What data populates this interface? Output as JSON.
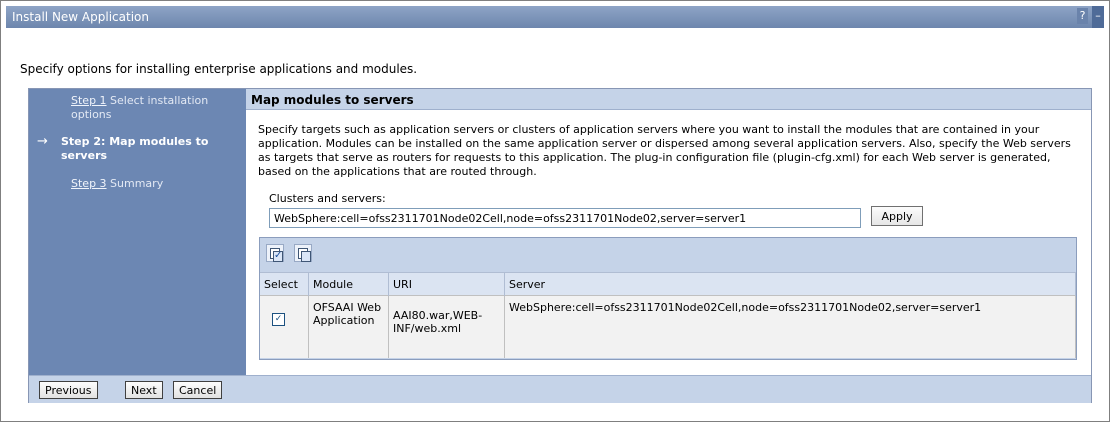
{
  "window": {
    "title": "Install New Application",
    "help": "?",
    "minimize": "–"
  },
  "intro": "Specify options for installing enterprise applications and modules.",
  "steps": [
    {
      "link": "Step 1",
      "label": "Select installation options"
    },
    {
      "arrow": "→",
      "label": "Step 2: Map modules to servers"
    },
    {
      "link": "Step 3",
      "label": "Summary"
    }
  ],
  "content": {
    "title": "Map modules to servers",
    "description": "Specify targets such as application servers or clusters of application servers where you want to install the modules that are contained in your application. Modules can be installed on the same application server or dispersed among several application servers. Also, specify the Web servers as targets that serve as routers for requests to this application. The plug-in configuration file (plugin-cfg.xml) for each Web server is generated, based on the applications that are routed through.",
    "clusters_label": "Clusters and servers:",
    "clusters_value": "WebSphere:cell=ofss2311701Node02Cell,node=ofss2311701Node02,server=server1",
    "apply_label": "Apply"
  },
  "table": {
    "columns": [
      "Select",
      "Module",
      "URI",
      "Server"
    ],
    "rows": [
      {
        "selected": "✓",
        "module": "OFSAAI Web Application",
        "uri": "AAI80.war,WEB-INF/web.xml",
        "server": "WebSphere:cell=ofss2311701Node02Cell,node=ofss2311701Node02,server=server1"
      }
    ]
  },
  "footer": {
    "previous": "Previous",
    "next": "Next",
    "cancel": "Cancel"
  }
}
